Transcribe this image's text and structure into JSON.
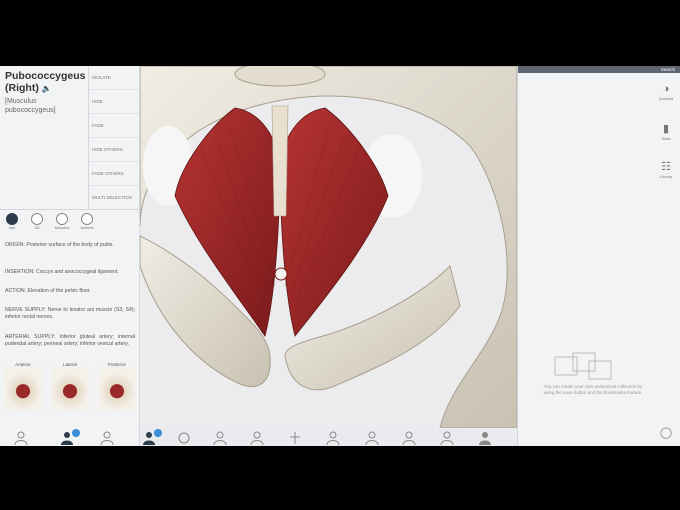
{
  "structure": {
    "title": "Pubococcygeus (Right)",
    "subtitle_line1": "[Musculus",
    "subtitle_line2": "pubococcygeus]"
  },
  "menu": [
    "Isolate",
    "Hide",
    "Fade",
    "Hide others",
    "Fade others",
    "Multi selection"
  ],
  "views": [
    {
      "label": "Info",
      "active": true
    },
    {
      "label": "3D",
      "active": false
    },
    {
      "label": "Muscles",
      "active": false
    },
    {
      "label": "Actions",
      "active": false
    }
  ],
  "description": {
    "origin": "ORIGIN: Posterior surface of the body of pubis.",
    "insertion": "INSERTION: Coccyx and anococcygeal ligament.",
    "action": "ACTION: Elevation of the pelvic floor.",
    "nerve": "NERVE SUPPLY: Nerve to levator ani muscle (S3, S4); inferior rectal nerves.",
    "arterial": "ARTERIAL SUPPLY: Inferior gluteal artery; internal pudendal artery; perineal artery; inferior vesical artery."
  },
  "thumbnails": [
    "Anterior",
    "Lateral",
    "Posterior"
  ],
  "toolbar_icons": [
    "person-icon",
    "group-icon",
    "muscle-icon",
    "group-icon-2",
    "skeleton-icon",
    "cardio-icon",
    "nervous-icon",
    "lymph-icon",
    "respiratory-icon",
    "digestive-icon",
    "urinary-icon",
    "reproductive-icon",
    "skin-icon",
    "profile-icon"
  ],
  "right_panel": {
    "search_label": "Search",
    "buttons": [
      {
        "label": "Quizzes",
        "icon": "quiz-icon"
      },
      {
        "label": "Stats",
        "icon": "stats-icon"
      },
      {
        "label": "Library",
        "icon": "library-icon"
      }
    ],
    "empty_note": "You can create your own anatomical collection by using the save button and the bookmarks feature."
  },
  "colors": {
    "muscle": "#9b2424",
    "bone": "#e6e1d6",
    "accent": "#3a8fd8",
    "panel": "#f2f3f4"
  }
}
